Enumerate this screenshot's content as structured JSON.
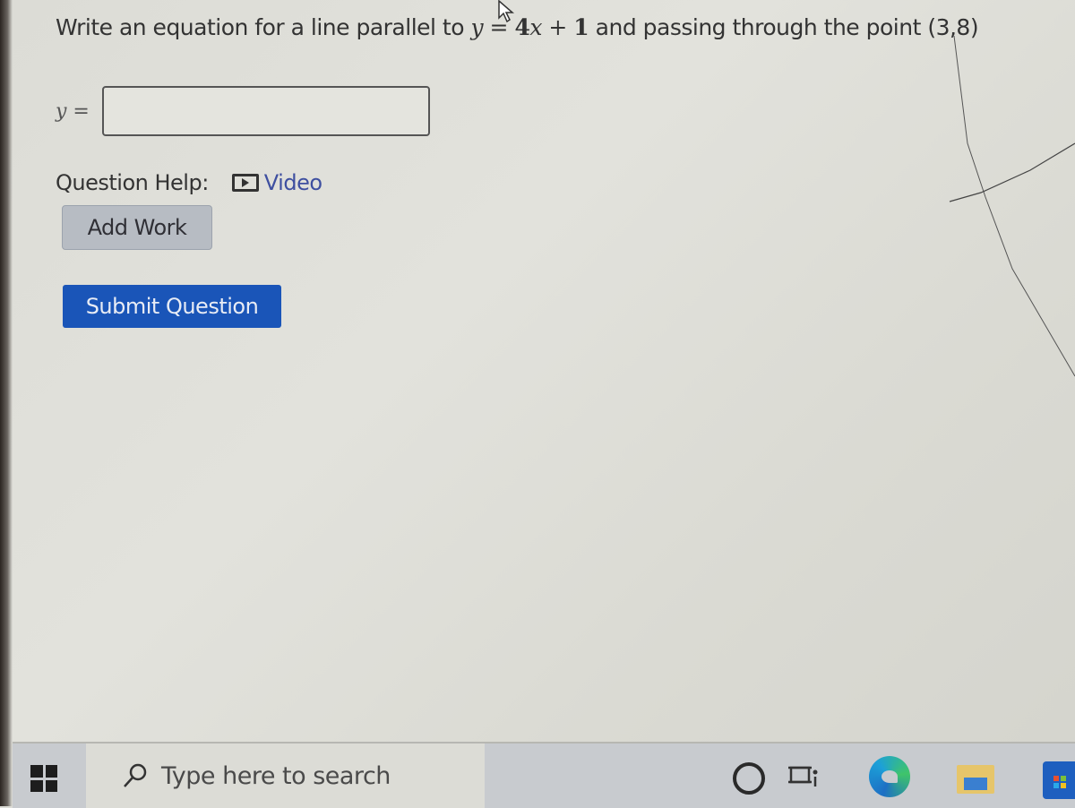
{
  "question": {
    "prefix": "Write an equation for a line parallel to ",
    "equation": {
      "y": "y",
      "equals": " = ",
      "coef": "4",
      "x": "x",
      "plus": " + ",
      "const": "1"
    },
    "suffix": " and passing through the point (3,8)"
  },
  "answer": {
    "label": "y =",
    "value": "",
    "placeholder": ""
  },
  "help": {
    "label": "Question Help:",
    "video_label": "Video",
    "video_icon": "video-play-icon"
  },
  "buttons": {
    "add_work": "Add Work",
    "submit": "Submit Question"
  },
  "colors": {
    "submit_bg": "#1a55b8",
    "link": "#3e4fa0",
    "add_work_bg": "#b7bcc3"
  },
  "taskbar": {
    "search_placeholder": "Type here to search",
    "icons": [
      "windows-start-icon",
      "search-icon",
      "cortana-icon",
      "task-view-icon",
      "edge-browser-icon",
      "file-explorer-icon",
      "microsoft-store-icon"
    ]
  }
}
